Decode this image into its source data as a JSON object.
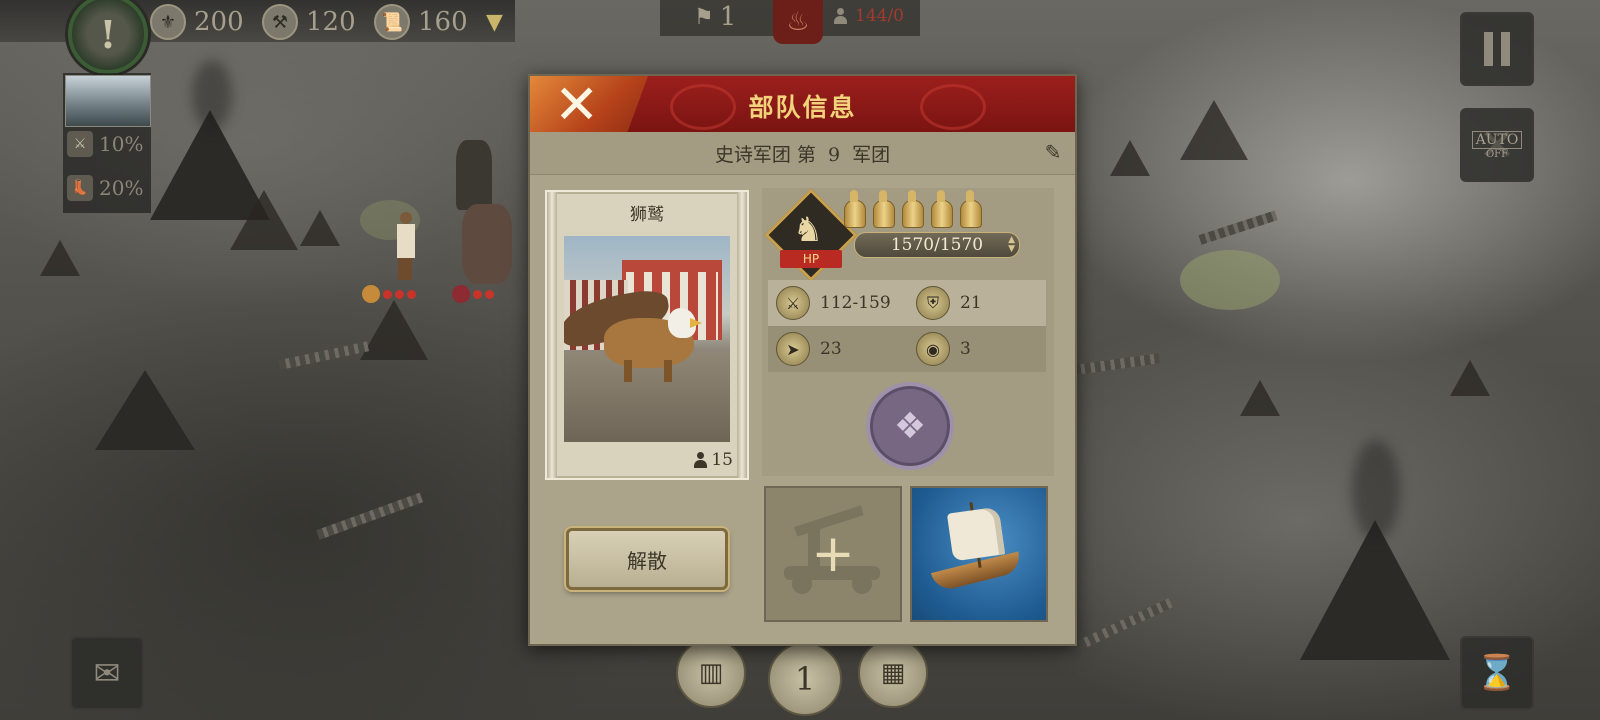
{
  "hud": {
    "resources": [
      {
        "icon": "coin-icon",
        "value": "200"
      },
      {
        "icon": "hammer-icon",
        "value": "120"
      },
      {
        "icon": "scroll-icon",
        "value": "160"
      }
    ],
    "flag_count": "1",
    "troop_capacity": "144/0",
    "left_panel": {
      "stats": [
        {
          "icon": "sword-shield-icon",
          "value": "10%"
        },
        {
          "icon": "boot-icon",
          "value": "20%"
        }
      ]
    },
    "auto_button": {
      "label": "AUTO",
      "state": "OFF"
    },
    "bottom_turn": "1"
  },
  "modal": {
    "title": "部队信息",
    "subtitle": "史诗军团 第  9  军团",
    "unit": {
      "name": "狮鹫",
      "count": "15"
    },
    "hp": {
      "badge_label": "HP",
      "value": "1570/1570",
      "fraction": 1.0,
      "rank_helmets": 5
    },
    "stats": [
      {
        "icon": "attack-icon",
        "value": "112-159"
      },
      {
        "icon": "armor-icon",
        "value": "21"
      },
      {
        "icon": "speed-icon",
        "value": "23"
      },
      {
        "icon": "vision-icon",
        "value": "3"
      }
    ],
    "ability_icon": "wolf-emblem-icon",
    "disband_label": "解散",
    "equipment_slots": [
      {
        "type": "empty",
        "icon": "add-catapult-icon"
      },
      {
        "type": "ship",
        "icon": "sailing-ship-icon"
      }
    ]
  },
  "colors": {
    "header_red": "#9c1f1c",
    "title_gold": "#f2d27b",
    "panel_beige": "#aba38a",
    "capacity_red": "#a13b2e"
  }
}
